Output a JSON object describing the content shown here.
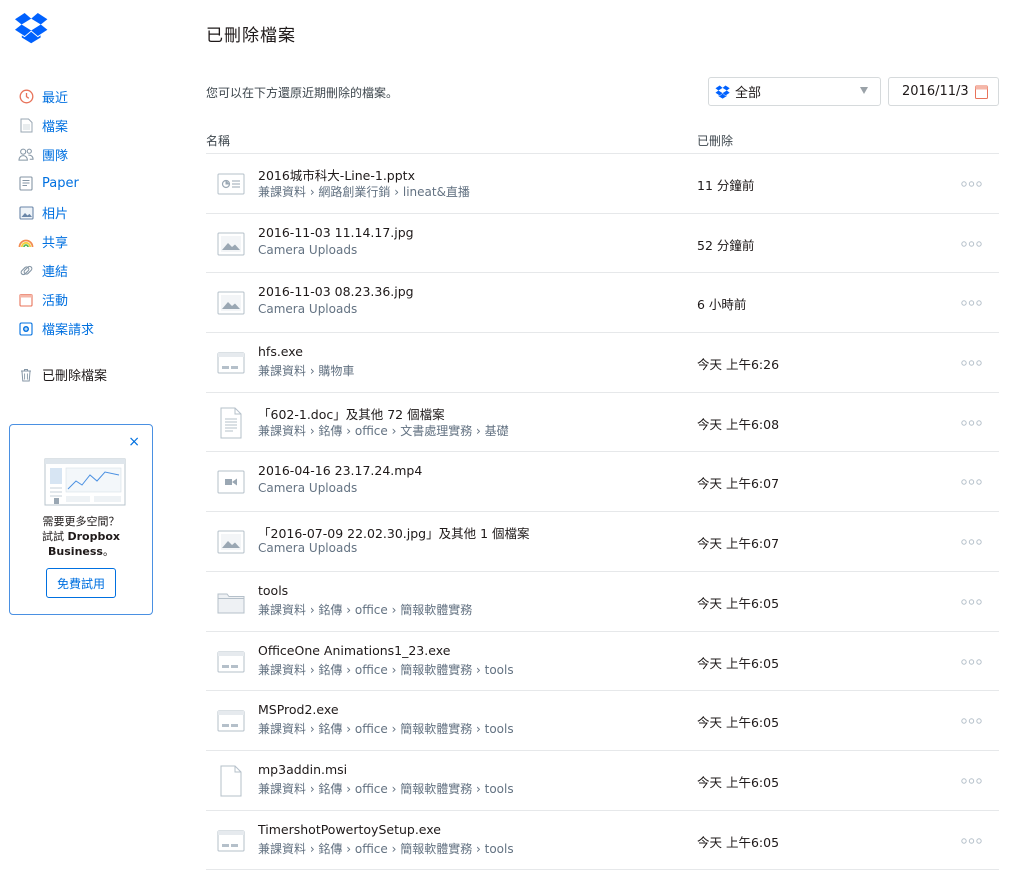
{
  "page": {
    "title": "已刪除檔案",
    "subtitle": "您可以在下方還原近期刪除的檔案。"
  },
  "sidebar": {
    "items": [
      {
        "label": "最近",
        "icon": "clock-icon"
      },
      {
        "label": "檔案",
        "icon": "file-icon"
      },
      {
        "label": "團隊",
        "icon": "team-icon"
      },
      {
        "label": "Paper",
        "icon": "paper-icon"
      },
      {
        "label": "相片",
        "icon": "photo-icon"
      },
      {
        "label": "共享",
        "icon": "rainbow-icon"
      },
      {
        "label": "連結",
        "icon": "link-icon"
      },
      {
        "label": "活動",
        "icon": "calendar-icon"
      },
      {
        "label": "檔案請求",
        "icon": "file-request-icon"
      }
    ],
    "deleted": {
      "label": "已刪除檔案",
      "icon": "trash-icon"
    }
  },
  "promo": {
    "close": "×",
    "line1": "需要更多空間？",
    "line2_prefix": "試試 ",
    "line2_bold": "Dropbox",
    "line3_bold": "Business",
    "line3_suffix": "。",
    "button": "免費試用"
  },
  "filter": {
    "selected": "全部",
    "date": "2016/11/3"
  },
  "table": {
    "headers": {
      "name": "名稱",
      "deleted": "已刪除"
    },
    "rows": [
      {
        "name": "2016城市科大-Line-1.pptx",
        "path": "兼課資料 › 網路創業行銷 › lineat&直播",
        "deleted": "11 分鐘前",
        "icon": "presentation"
      },
      {
        "name": "2016-11-03 11.14.17.jpg",
        "path": "Camera Uploads",
        "deleted": "52 分鐘前",
        "icon": "image"
      },
      {
        "name": "2016-11-03 08.23.36.jpg",
        "path": "Camera Uploads",
        "deleted": "6 小時前",
        "icon": "image"
      },
      {
        "name": "hfs.exe",
        "path": "兼課資料 › 購物車",
        "deleted": "今天 上午6:26",
        "icon": "exe"
      },
      {
        "name": "「602-1.doc」及其他 72 個檔案",
        "path": "兼課資料 › 銘傳 › office › 文書處理實務 › 基礎",
        "deleted": "今天 上午6:08",
        "icon": "doc"
      },
      {
        "name": "2016-04-16 23.17.24.mp4",
        "path": "Camera Uploads",
        "deleted": "今天 上午6:07",
        "icon": "video"
      },
      {
        "name": "「2016-07-09 22.02.30.jpg」及其他 1 個檔案",
        "path": "Camera Uploads",
        "deleted": "今天 上午6:07",
        "icon": "image"
      },
      {
        "name": "tools",
        "path": "兼課資料 › 銘傳 › office › 簡報軟體實務",
        "deleted": "今天 上午6:05",
        "icon": "folder"
      },
      {
        "name": "OfficeOne Animations1_23.exe",
        "path": "兼課資料 › 銘傳 › office › 簡報軟體實務 › tools",
        "deleted": "今天 上午6:05",
        "icon": "exe"
      },
      {
        "name": "MSProd2.exe",
        "path": "兼課資料 › 銘傳 › office › 簡報軟體實務 › tools",
        "deleted": "今天 上午6:05",
        "icon": "exe"
      },
      {
        "name": "mp3addin.msi",
        "path": "兼課資料 › 銘傳 › office › 簡報軟體實務 › tools",
        "deleted": "今天 上午6:05",
        "icon": "blank"
      },
      {
        "name": "TimershotPowertoySetup.exe",
        "path": "兼課資料 › 銘傳 › office › 簡報軟體實務 › tools",
        "deleted": "今天 上午6:05",
        "icon": "exe"
      }
    ]
  },
  "colors": {
    "accent": "#0070e0",
    "promo_border": "#4a90e2",
    "divider": "#e6e8ea"
  }
}
